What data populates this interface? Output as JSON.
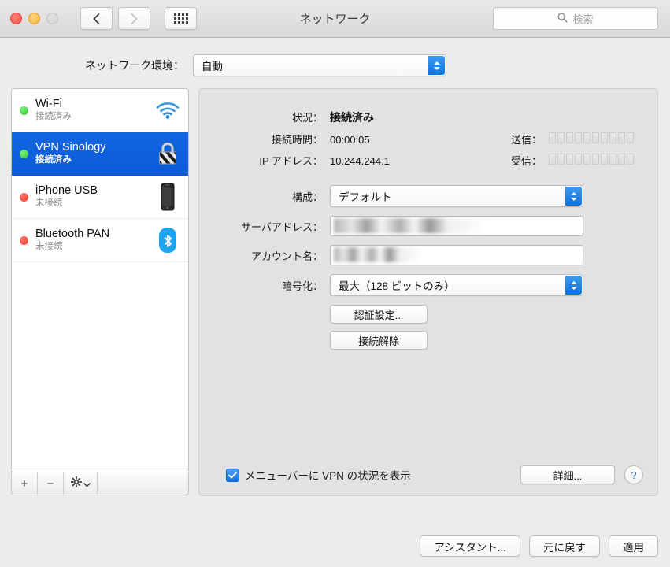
{
  "window": {
    "title": "ネットワーク",
    "traffic_lights": [
      "close",
      "minimize",
      "zoom-disabled"
    ],
    "back_label": "戻る",
    "forward_label": "進む",
    "showall_label": "すべてを表示"
  },
  "search": {
    "placeholder": "検索",
    "icon": "search-icon"
  },
  "location": {
    "label": "ネットワーク環境：",
    "value": "自動"
  },
  "sidebar": {
    "services": [
      {
        "name": "Wi-Fi",
        "state": "接続済み",
        "dot": "green",
        "icon": "wifi-icon",
        "selected": false
      },
      {
        "name": "VPN Sinology",
        "state": "接続済み",
        "dot": "green",
        "icon": "vpn-lock-icon",
        "selected": true
      },
      {
        "name": "iPhone USB",
        "state": "未接続",
        "dot": "red",
        "icon": "iphone-icon",
        "selected": false
      },
      {
        "name": "Bluetooth PAN",
        "state": "未接続",
        "dot": "red",
        "icon": "bluetooth-icon",
        "selected": false
      }
    ],
    "toolbar": {
      "add": "+",
      "remove": "−",
      "action": "⚙"
    }
  },
  "main": {
    "status": {
      "status_label": "状況：",
      "status_value": "接続済み",
      "time_label": "接続時間：",
      "time_value": "00:00:05",
      "ip_label": "IP アドレス：",
      "ip_value": "10.244.244.1",
      "sent_label": "送信：",
      "received_label": "受信：",
      "meter_segments": 10,
      "sent_active": 0,
      "received_active": 0
    },
    "form": {
      "config_label": "構成：",
      "config_value": "デフォルト",
      "server_label": "サーバアドレス：",
      "server_value": "",
      "account_label": "アカウント名：",
      "account_value": "",
      "encryption_label": "暗号化：",
      "encryption_value": "最大（128 ビットのみ）",
      "auth_button": "認証設定...",
      "disconnect_button": "接続解除"
    },
    "footer": {
      "menubar_checkbox_label": "メニューバーに VPN の状況を表示",
      "menubar_checked": true,
      "advanced_button": "詳細...",
      "help_button": "?"
    }
  },
  "window_footer": {
    "assistant_button": "アシスタント...",
    "revert_button": "元に戻す",
    "apply_button": "適用"
  },
  "colors": {
    "selection_blue": "#0b5bd6",
    "accent_blue": "#1073e6",
    "status_green": "#2fc82c",
    "status_red": "#f0372a",
    "window_bg": "#ececec",
    "panel_bg": "#e2e2e2"
  }
}
